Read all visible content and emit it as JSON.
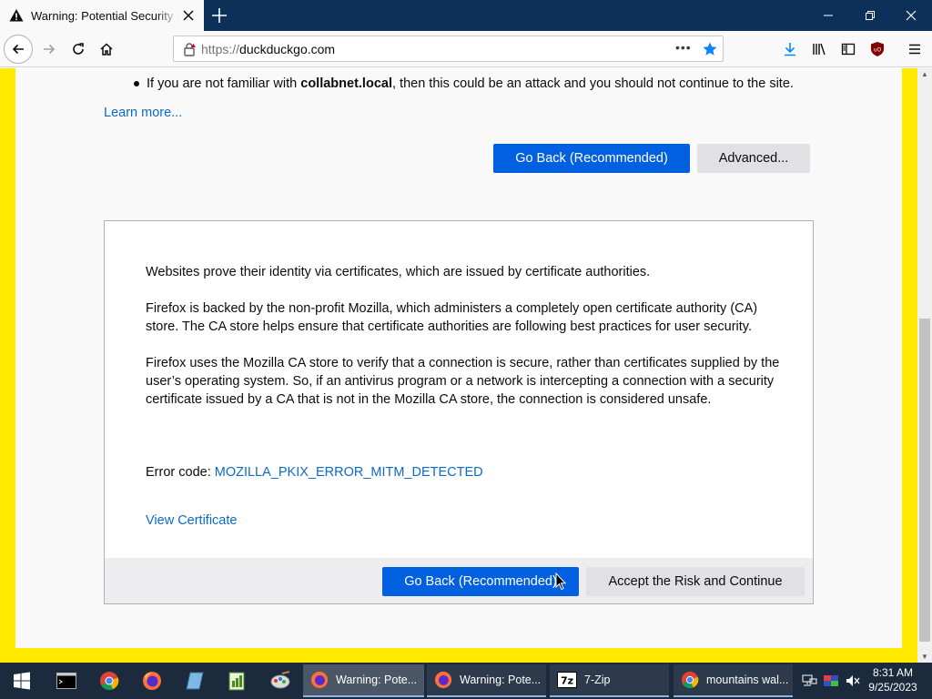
{
  "browser": {
    "tab_title": "Warning: Potential Security Risk Ahead",
    "url_prefix": "https://",
    "url_domain": "duckduckgo.com",
    "url_menu": "•••"
  },
  "page": {
    "bullet_prefix": "If you are not familiar with ",
    "bullet_domain": "collabnet.local",
    "bullet_suffix": ", then this could be an attack and you should not continue to the site.",
    "learn_more": "Learn more...",
    "go_back_label": "Go Back (Recommended)",
    "advanced_label": "Advanced...",
    "advanced": {
      "paragraphs": [
        "Websites prove their identity via certificates, which are issued by certificate authorities.",
        "Firefox is backed by the non-profit Mozilla, which administers a completely open certificate authority (CA) store. The CA store helps ensure that certificate authorities are following best practices for user security.",
        "Firefox uses the Mozilla CA store to verify that a connection is secure, rather than certificates supplied by the user’s operating system. So, if an antivirus program or a network is intercepting a connection with a security certificate issued by a CA that is not in the Mozilla CA store, the connection is considered unsafe."
      ],
      "error_code_label": "Error code: ",
      "error_code": "MOZILLA_PKIX_ERROR_MITM_DETECTED",
      "view_certificate": "View Certificate",
      "go_back_label": "Go Back (Recommended)",
      "accept_label": "Accept the Risk and Continue"
    }
  },
  "taskbar": {
    "tasks": [
      {
        "label": "Warning: Pote..."
      },
      {
        "label": "Warning: Pote..."
      },
      {
        "label": "7-Zip"
      },
      {
        "label": "mountains wal..."
      }
    ],
    "time": "8:31 AM",
    "date": "9/25/2023"
  },
  "colors": {
    "accent_blue": "#0060df",
    "frame_yellow": "#ffea00",
    "link": "#0a6bc9",
    "tab_bar": "#0c3057"
  }
}
